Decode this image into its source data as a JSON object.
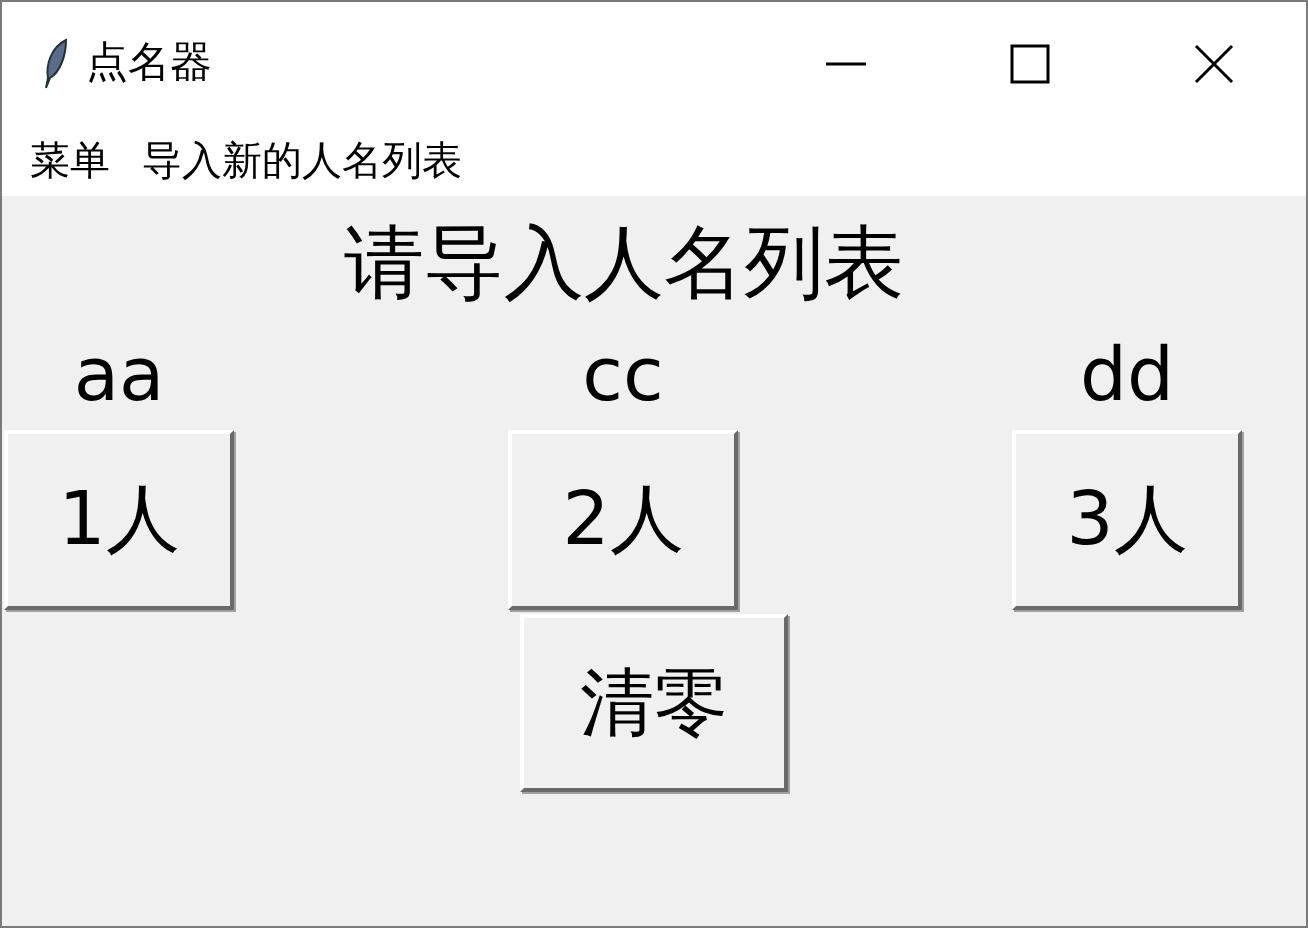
{
  "window": {
    "title": "点名器"
  },
  "menu": [
    "菜单",
    "导入新的人名列表"
  ],
  "heading": "请导入人名列表",
  "groups": [
    {
      "name": "aa",
      "button": "1人"
    },
    {
      "name": "cc",
      "button": "2人"
    },
    {
      "name": "dd",
      "button": "3人"
    }
  ],
  "clear_button": "清零"
}
